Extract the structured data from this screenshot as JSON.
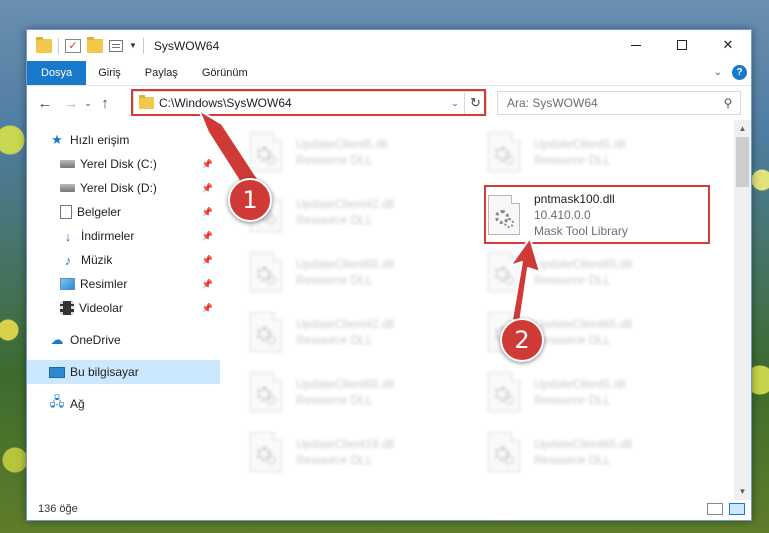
{
  "window": {
    "title": "SysWOW64"
  },
  "ribbon": {
    "tabs": [
      "Dosya",
      "Giriş",
      "Paylaş",
      "Görünüm"
    ]
  },
  "address": {
    "path": "C:\\Windows\\SysWOW64"
  },
  "search": {
    "placeholder": "Ara: SysWOW64"
  },
  "nav": {
    "quick_access": "Hızlı erişim",
    "items": [
      {
        "label": "Yerel Disk (C:)",
        "icon": "disk-icon"
      },
      {
        "label": "Yerel Disk (D:)",
        "icon": "disk-icon"
      },
      {
        "label": "Belgeler",
        "icon": "documents-icon"
      },
      {
        "label": "İndirmeler",
        "icon": "downloads-icon"
      },
      {
        "label": "Müzik",
        "icon": "music-icon"
      },
      {
        "label": "Resimler",
        "icon": "pictures-icon"
      },
      {
        "label": "Videolar",
        "icon": "videos-icon"
      }
    ],
    "onedrive": "OneDrive",
    "this_pc": "Bu bilgisayar",
    "network": "Ağ"
  },
  "files": {
    "left": [
      {
        "name": "UpdateClient5.dll",
        "desc": "Resource DLL"
      },
      {
        "name": "UpdateClient42.dll",
        "desc": "Resource DLL"
      },
      {
        "name": "UpdateClient65.dll",
        "desc": "Resource DLL"
      },
      {
        "name": "UpdateClient42.dll",
        "desc": "Resource DLL"
      },
      {
        "name": "UpdateClient65.dll",
        "desc": "Resource DLL"
      },
      {
        "name": "UpdateClient19.dll",
        "desc": "Resource DLL"
      }
    ],
    "right": [
      {
        "name": "UpdateClient5.dll",
        "desc": "Resource DLL"
      },
      {
        "name": "pntmask100.dll",
        "desc": "10.410.0.0",
        "desc2": "Mask Tool Library"
      },
      {
        "name": "UpdateClient65.dll",
        "desc": "Resource DLL"
      },
      {
        "name": "UpdateClient65.dll",
        "desc": "Resource DLL"
      },
      {
        "name": "UpdateClient5.dll",
        "desc": "Resource DLL"
      },
      {
        "name": "UpdateClient65.dll",
        "desc": "Resource DLL"
      }
    ]
  },
  "status": {
    "count": "136 öğe"
  },
  "annotations": {
    "step1": "1",
    "step2": "2",
    "color": "#cf3a36"
  }
}
